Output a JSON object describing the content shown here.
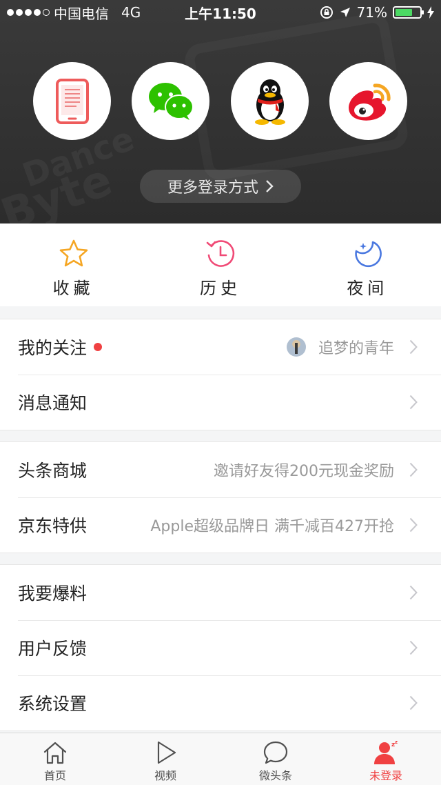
{
  "status_bar": {
    "carrier": "中国电信",
    "network": "4G",
    "time": "上午11:50",
    "battery": "71%",
    "battery_level": 0.71
  },
  "header": {
    "login_options": [
      {
        "name": "phone",
        "icon": "phone-icon"
      },
      {
        "name": "wechat",
        "icon": "wechat-icon"
      },
      {
        "name": "qq",
        "icon": "qq-icon"
      },
      {
        "name": "weibo",
        "icon": "weibo-icon"
      }
    ],
    "more_login_label": "更多登录方式",
    "watermark_1": "Dance",
    "watermark_2": "Byte"
  },
  "quick_actions": [
    {
      "label": "收藏",
      "icon": "star-icon",
      "color": "#f5a623"
    },
    {
      "label": "历史",
      "icon": "clock-icon",
      "color": "#f04a76"
    },
    {
      "label": "夜间",
      "icon": "moon-icon",
      "color": "#4a78e0"
    }
  ],
  "groups": [
    [
      {
        "label": "我的关注",
        "badge": true,
        "right_text": "追梦的青年",
        "avatar": true
      },
      {
        "label": "消息通知",
        "right_text": ""
      }
    ],
    [
      {
        "label": "头条商城",
        "right_text": "邀请好友得200元现金奖励"
      },
      {
        "label": "京东特供",
        "right_text": "Apple超级品牌日 满千减百427开抢"
      }
    ],
    [
      {
        "label": "我要爆料",
        "right_text": ""
      },
      {
        "label": "用户反馈",
        "right_text": ""
      },
      {
        "label": "系统设置",
        "right_text": ""
      }
    ]
  ],
  "tabbar": [
    {
      "label": "首页",
      "icon": "home-icon",
      "active": false
    },
    {
      "label": "视频",
      "icon": "play-icon",
      "active": false
    },
    {
      "label": "微头条",
      "icon": "chat-bubble-icon",
      "active": false
    },
    {
      "label": "未登录",
      "icon": "user-icon",
      "active": true
    }
  ],
  "colors": {
    "accent": "#f04142",
    "header_bg": "#333333",
    "battery": "#4cd964"
  }
}
